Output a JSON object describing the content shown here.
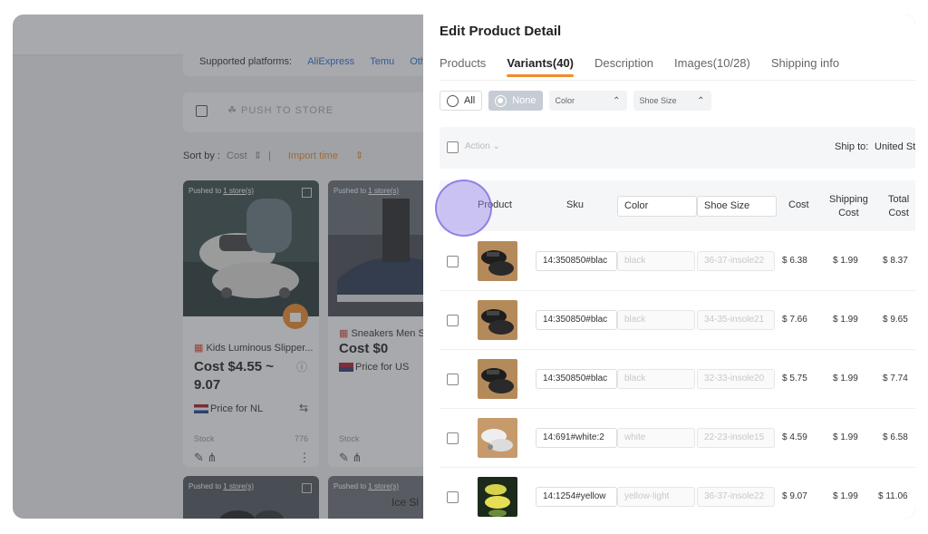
{
  "background": {
    "platforms_label": "Supported platforms:",
    "platforms": [
      "AliExpress",
      "Temu",
      "Oth"
    ],
    "push_label": "PUSH TO STORE",
    "sort_label": "Sort by :",
    "sort_cost": "Cost",
    "sort_import": "Import time",
    "cards": [
      {
        "pushed": "Pushed to",
        "store": "1 store(s)",
        "title": "Kids Luminous Slipper...",
        "cost_line1": "Cost $4.55 ~",
        "cost_line2": "9.07",
        "price_for": "Price for NL",
        "stock_label": "Stock",
        "stock_value": "776"
      },
      {
        "pushed": "Pushed to",
        "store": "1 store(s)",
        "title": "Sneakers Men Sh",
        "cost_line1": "Cost $0",
        "cost_line2": "",
        "price_for": "Price for US",
        "stock_label": "Stock",
        "stock_value": ""
      },
      {
        "pushed": "Pushed to",
        "store": "1 store(s)"
      },
      {
        "pushed": "Pushed to",
        "store": "1 store(s)",
        "title": "Ice Sl"
      }
    ]
  },
  "drawer": {
    "title": "Edit Product Detail",
    "tabs": [
      "Products",
      "Variants(40)",
      "Description",
      "Images(10/28)",
      "Shipping info"
    ],
    "active_tab": "Variants(40)",
    "filter_all": "All",
    "filter_none": "None",
    "filter_color": "Color",
    "filter_shoe": "Shoe Size",
    "action_label": "Action",
    "ship_to_label": "Ship to:",
    "ship_to_value": "United St",
    "headers": {
      "product": "Product",
      "sku": "Sku",
      "color": "Color",
      "shoe_size": "Shoe Size",
      "cost": "Cost",
      "shipping_cost": [
        "Shipping",
        "Cost"
      ],
      "total_cost": [
        "Total",
        "Cost"
      ]
    },
    "rows": [
      {
        "sku": "14:350850#blac",
        "color": "black",
        "size": "36-37-insole22",
        "cost": "$ 6.38",
        "shipping": "$ 1.99",
        "total": "$ 8.37",
        "thumb": "black"
      },
      {
        "sku": "14:350850#blac",
        "color": "black",
        "size": "34-35-insole21",
        "cost": "$ 7.66",
        "shipping": "$ 1.99",
        "total": "$ 9.65",
        "thumb": "black"
      },
      {
        "sku": "14:350850#blac",
        "color": "black",
        "size": "32-33-insole20",
        "cost": "$ 5.75",
        "shipping": "$ 1.99",
        "total": "$ 7.74",
        "thumb": "black"
      },
      {
        "sku": "14:691#white:2",
        "color": "white",
        "size": "22-23-insole15",
        "cost": "$ 4.59",
        "shipping": "$ 1.99",
        "total": "$ 6.58",
        "thumb": "white"
      },
      {
        "sku": "14:1254#yellow",
        "color": "yellow-light",
        "size": "36-37-insole22",
        "cost": "$ 9.07",
        "shipping": "$ 1.99",
        "total": "$ 11.06",
        "thumb": "yellow"
      }
    ]
  },
  "colors": {
    "accent": "#f08c2a",
    "link": "#2f6fd6",
    "overlay": "#3c4048"
  }
}
